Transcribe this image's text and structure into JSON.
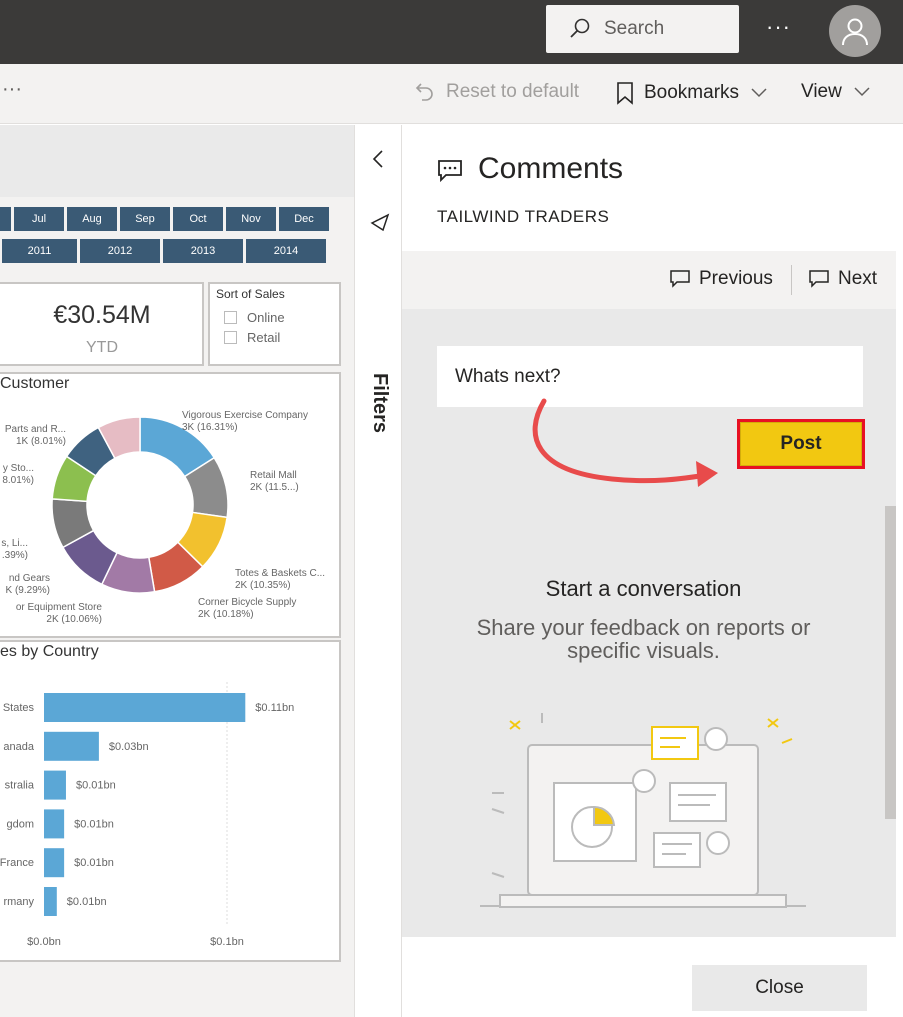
{
  "topbar": {
    "search_placeholder": "Search",
    "more": "···"
  },
  "actionbar": {
    "more": "···",
    "reset": "Reset to default",
    "bookmarks": "Bookmarks",
    "view": "View"
  },
  "report": {
    "months": [
      "Jul",
      "Aug",
      "Sep",
      "Oct",
      "Nov",
      "Dec"
    ],
    "years": [
      "2011",
      "2012",
      "2013",
      "2014"
    ],
    "kpi_value": "€30.54M",
    "kpi_label": "YTD",
    "sort_title": "Sort of Sales",
    "sort_options": [
      "Online",
      "Retail"
    ],
    "donut_title": "Customer",
    "bar_title": "es by Country"
  },
  "chart_data": [
    {
      "type": "pie",
      "title": "Customer",
      "colors": [
        "#5ba7d6",
        "#8c8c8c",
        "#f2c12e",
        "#d15a47",
        "#a27aa6",
        "#6b5a8e",
        "#7a7a7a",
        "#8cbf4f",
        "#3f6280",
        "#e6bcc4"
      ],
      "slice_values": [
        16.31,
        11.5,
        10.35,
        10.18,
        10.0,
        10.06,
        9.29,
        8.39,
        8.0,
        8.01
      ],
      "labels": [
        {
          "line1": "Vigorous Exercise Company",
          "line2": "3K (16.31%)"
        },
        {
          "line1": "Retail Mall",
          "line2": "2K (11.5...)"
        },
        {
          "line1": "Totes & Baskets C...",
          "line2": "2K (10.35%)"
        },
        {
          "line1": "Corner Bicycle Supply",
          "line2": "2K (10.18%)"
        },
        {
          "line1": "or Equipment Store",
          "line2": "2K (10.06%)"
        },
        {
          "line1": "nd Gears",
          "line2": "K (9.29%)"
        },
        {
          "line1": "s, Li...",
          "line2": ".39%)"
        },
        {
          "line1": "y Sto...",
          "line2": "8.01%)"
        },
        {
          "line1": "Parts and R...",
          "line2": "1K (8.01%)"
        }
      ]
    },
    {
      "type": "bar",
      "title": "es by Country",
      "categories": [
        "States",
        "anada",
        "stralia",
        "gdom",
        "France",
        "rmany"
      ],
      "values": [
        0.11,
        0.03,
        0.012,
        0.011,
        0.011,
        0.007
      ],
      "value_labels": [
        "$0.11bn",
        "$0.03bn",
        "$0.01bn",
        "$0.01bn",
        "$0.01bn",
        "$0.01bn"
      ],
      "xlim": [
        0,
        0.1
      ],
      "x_ticks": [
        "$0.0bn",
        "$0.1bn"
      ],
      "color": "#5ba7d6"
    }
  ],
  "comments": {
    "title": "Comments",
    "subtitle": "TAILWIND TRADERS",
    "previous": "Previous",
    "next": "Next",
    "input_value": "Whats next?",
    "post": "Post",
    "conv_title": "Start a conversation",
    "conv_text": "Share your feedback on reports or specific visuals.",
    "close": "Close"
  },
  "filters": {
    "label": "Filters"
  },
  "colors": {
    "accent": "#f2c811",
    "highlight": "#e81123",
    "arrow": "#e84b4b"
  }
}
